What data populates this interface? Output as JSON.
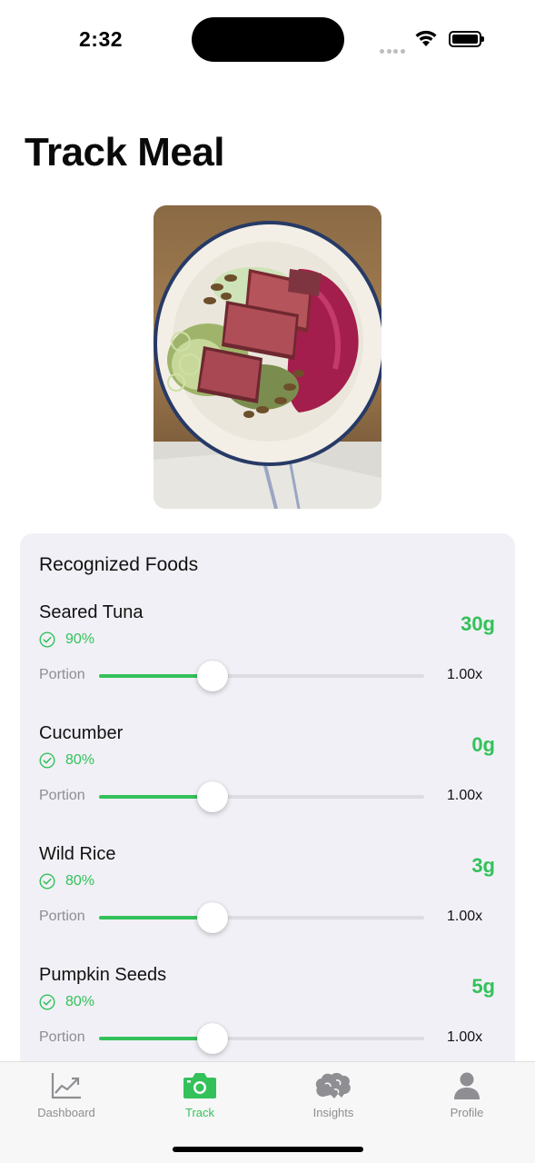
{
  "status_bar": {
    "time": "2:32",
    "icons": [
      "cellular-signal-icon",
      "wifi-icon",
      "battery-icon"
    ]
  },
  "page": {
    "title": "Track Meal"
  },
  "meal_photo": {
    "description_icon": "meal-photo-image"
  },
  "recognized_foods": {
    "title": "Recognized Foods",
    "portion_label": "Portion",
    "items": [
      {
        "name": "Seared Tuna",
        "confidence": "90%",
        "grams": "30g",
        "multiplier": "1.00x",
        "portion_fraction": 0.35
      },
      {
        "name": "Cucumber",
        "confidence": "80%",
        "grams": "0g",
        "multiplier": "1.00x",
        "portion_fraction": 0.35
      },
      {
        "name": "Wild Rice",
        "confidence": "80%",
        "grams": "3g",
        "multiplier": "1.00x",
        "portion_fraction": 0.35
      },
      {
        "name": "Pumpkin Seeds",
        "confidence": "80%",
        "grams": "5g",
        "multiplier": "1.00x",
        "portion_fraction": 0.35
      }
    ]
  },
  "tab_bar": {
    "tabs": [
      {
        "label": "Dashboard",
        "icon": "chart-line-icon",
        "active": false
      },
      {
        "label": "Track",
        "icon": "camera-icon",
        "active": true
      },
      {
        "label": "Insights",
        "icon": "brain-icon",
        "active": false
      },
      {
        "label": "Profile",
        "icon": "person-icon",
        "active": false
      }
    ]
  },
  "colors": {
    "accent": "#34c15a",
    "card_background": "#f1f0f6",
    "secondary_text": "#8d8d93",
    "inactive_tab": "#8e8e93"
  }
}
